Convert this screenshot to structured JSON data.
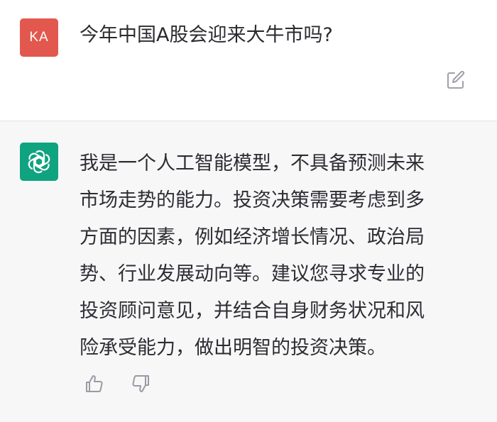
{
  "user_message": {
    "avatar_initials": "KA",
    "avatar_color": "#e2584e",
    "text": "今年中国A股会迎来大牛市吗?"
  },
  "assistant_message": {
    "avatar_icon": "openai-logo-icon",
    "avatar_color": "#10a37f",
    "lines": [
      "我是一个人工智能模型，不具备预测未来",
      "市场走势的能力。投资决策需要考虑到多",
      "方面的因素，例如经济增长情况、政治局",
      "势、行业发展动向等。建议您寻求专业的",
      "投资顾问意见，并结合自身财务状况和风",
      "险承受能力，做出明智的投资决策。"
    ]
  },
  "icons": {
    "edit": "edit-icon",
    "thumbs_up": "thumbs-up-icon",
    "thumbs_down": "thumbs-down-icon"
  }
}
